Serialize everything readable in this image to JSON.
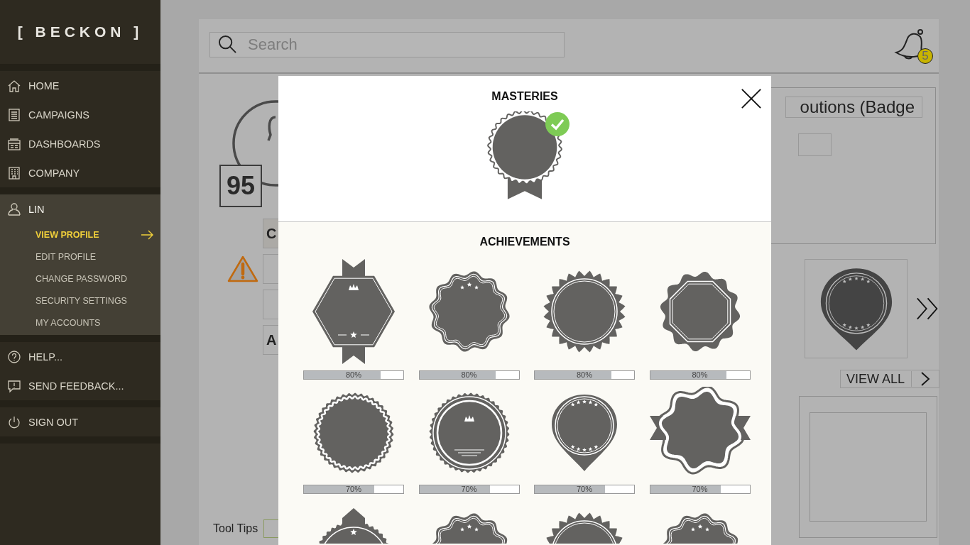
{
  "sidebar": {
    "logo": "[ BECKON ]",
    "sections": [
      {
        "items": [
          {
            "label": "HOME"
          },
          {
            "label": "CAMPAIGNS"
          },
          {
            "label": "DASHBOARDS"
          },
          {
            "label": "COMPANY"
          }
        ]
      },
      {
        "items": [
          {
            "label": "LIN",
            "expanded": true,
            "children": [
              {
                "label": "VIEW PROFILE",
                "selected": true
              },
              {
                "label": "EDIT PROFILE",
                "selected": false
              },
              {
                "label": "CHANGE PASSWORD",
                "selected": false
              },
              {
                "label": "SECURITY SETTINGS",
                "selected": false
              },
              {
                "label": "MY ACCOUNTS",
                "selected": false
              }
            ]
          }
        ]
      },
      {
        "items": [
          {
            "label": "HELP..."
          },
          {
            "label": "SEND FEEDBACK..."
          }
        ]
      },
      {
        "items": [
          {
            "label": "SIGN OUT"
          }
        ]
      }
    ]
  },
  "header": {
    "search": {
      "placeholder": "Search"
    },
    "notifications": {
      "count": "5"
    }
  },
  "profile": {
    "score": "95",
    "buttons": [
      {
        "label": "C"
      },
      {
        "label": "A"
      }
    ],
    "tool_tips": {
      "label": "Tool Tips"
    }
  },
  "contributions": {
    "title": "outions (Badge",
    "view_all": "VIEW ALL"
  },
  "modal": {
    "masteries": {
      "title": "MASTERIES",
      "completed": true
    },
    "achievements": {
      "title": "ACHIEVEMENTS",
      "items": [
        {
          "kind": "hexagon",
          "level": 0.77,
          "reading": "80%"
        },
        {
          "kind": "scallop",
          "level": 0.77,
          "reading": "80%"
        },
        {
          "kind": "seal",
          "level": 0.77,
          "reading": "80%"
        },
        {
          "kind": "octagon",
          "level": 0.77,
          "reading": "80%"
        },
        {
          "kind": "rope",
          "level": 0.71,
          "reading": "70%"
        },
        {
          "kind": "crown",
          "level": 0.71,
          "reading": "70%"
        },
        {
          "kind": "pin",
          "level": 0.71,
          "reading": "70%"
        },
        {
          "kind": "ribbon",
          "level": 0.71,
          "reading": "70%"
        },
        {
          "kind": "crest"
        },
        {
          "kind": "scallop"
        },
        {
          "kind": "seal"
        },
        {
          "kind": "scallop"
        }
      ]
    }
  }
}
